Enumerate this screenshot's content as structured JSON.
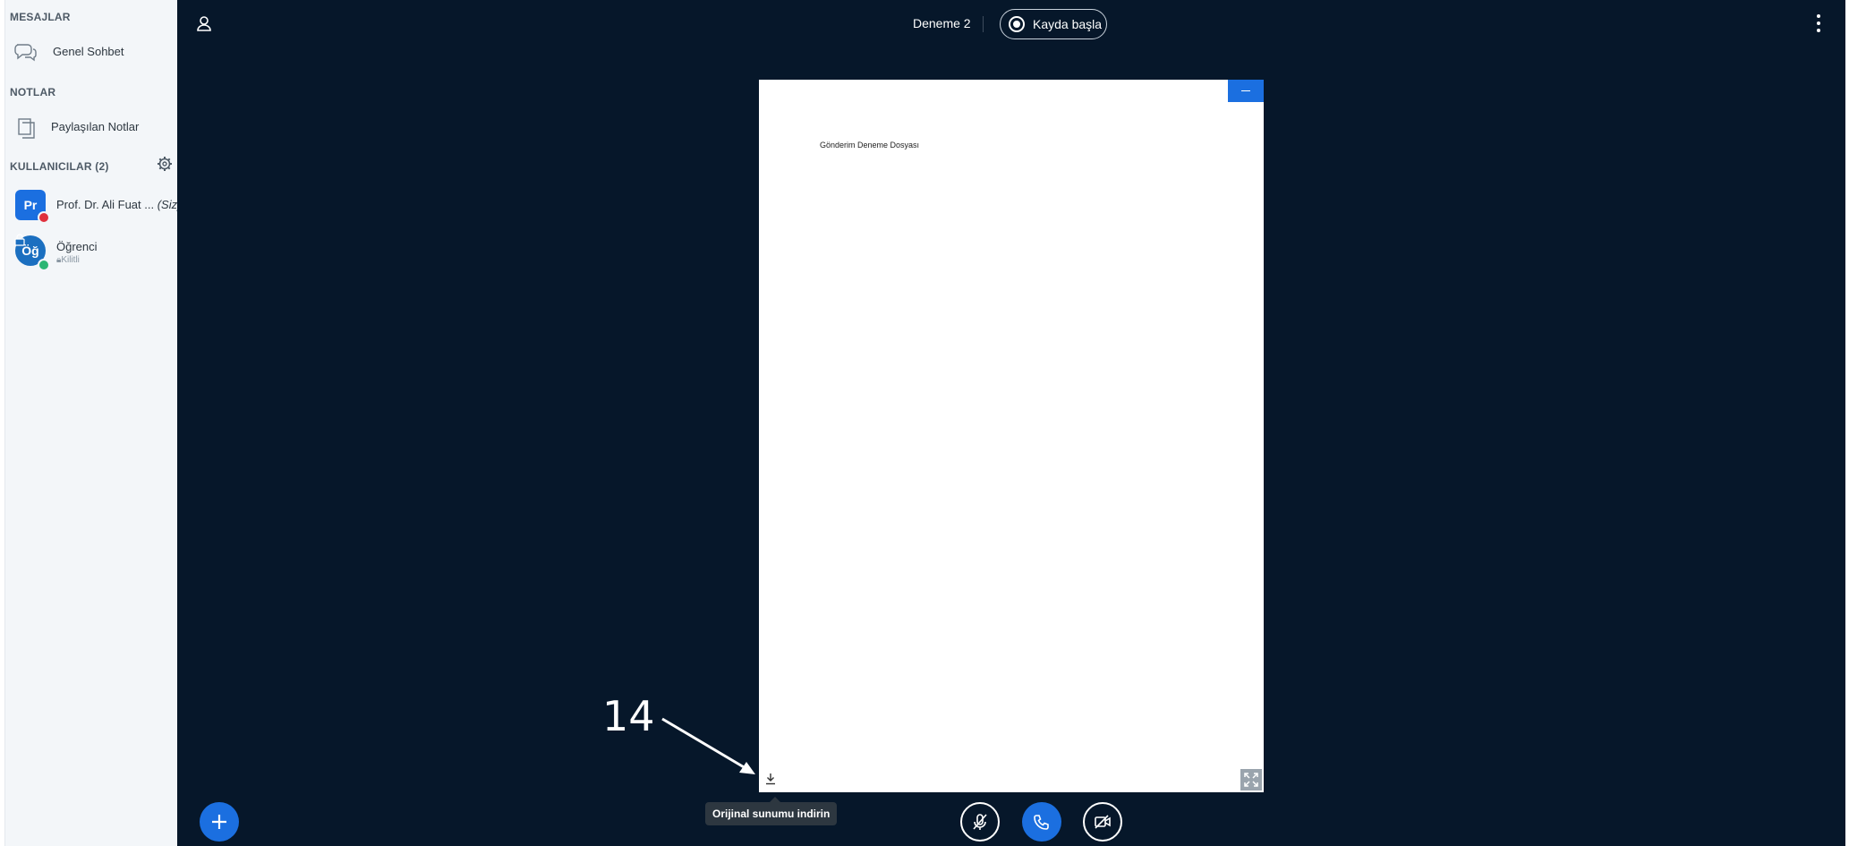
{
  "sidebar": {
    "messages_title": "MESAJLAR",
    "public_chat_label": "Genel Sohbet",
    "notes_title": "NOTLAR",
    "shared_notes_label": "Paylaşılan Notlar",
    "users_title": "KULLANICILAR (2)",
    "users": [
      {
        "initials": "Pr",
        "name": "Prof. Dr. Ali Fuat ...",
        "suffix": "(Siz)",
        "badge_color": "#e0313d"
      },
      {
        "initials": "Öğ",
        "name": "Öğrenci",
        "sub": "Kilitli",
        "badge_color": "#2bb673"
      }
    ]
  },
  "header": {
    "meeting_title": "Deneme 2",
    "record_label": "Kayda başla"
  },
  "presentation": {
    "slide_text": "Gönderim Deneme Dosyası",
    "download_tooltip": "Orijinal sunumu indirin"
  },
  "annotation": {
    "number": "14"
  },
  "colors": {
    "main_bg": "#06172a",
    "accent_blue": "#1b6fe0",
    "sidebar_bg": "#f3f6f9"
  },
  "icons": {
    "public_chat": "chat-bubbles-icon",
    "shared_notes": "document-copy-icon",
    "users_settings": "gear-icon",
    "header_user": "user-icon",
    "record": "record-icon",
    "options": "kebab-menu-icon",
    "minimize": "minimize-icon",
    "download": "download-icon",
    "fullscreen": "fullscreen-icon",
    "actions": "plus-icon",
    "microphone": "mic-muted-icon",
    "phone": "phone-icon",
    "camera": "camera-off-icon"
  }
}
